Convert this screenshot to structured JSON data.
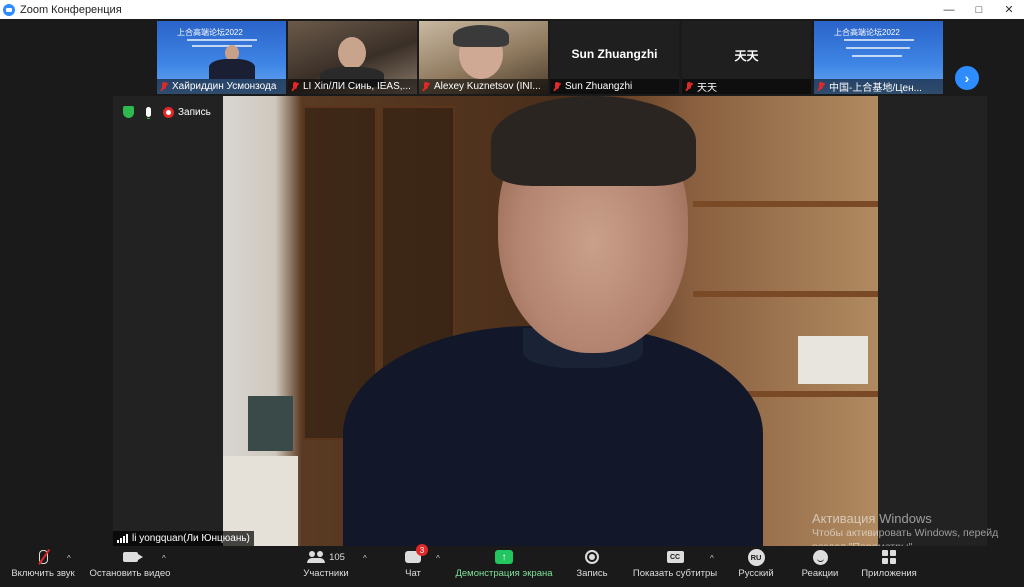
{
  "window": {
    "title": "Zoom Конференция",
    "controls": [
      "—",
      "□",
      "✕"
    ]
  },
  "participants": [
    {
      "name": "Хайриддин Усмонзода",
      "muted": true
    },
    {
      "name": "LI Xin/ЛИ Синь, IEAS,...",
      "muted": true
    },
    {
      "name": "Alexey Kuznetsov (INI...",
      "muted": true
    },
    {
      "name": "Sun  Zhuangzhi",
      "center_name": "Sun  Zhuangzhi",
      "muted": true
    },
    {
      "name": "天天",
      "center_name": "天天",
      "muted": true
    },
    {
      "name": "中国-上合基地/Цен...",
      "muted": true
    }
  ],
  "poster_text": "上合高端论坛2022",
  "main": {
    "recording_label": "Запись",
    "speaker_name": "li yongquan(Ли Юнцюань)"
  },
  "activation": {
    "title": "Активация Windows",
    "line1": "Чтобы активировать Windows, перейд",
    "line2": "раздел \"Параметры\"."
  },
  "toolbar": {
    "unmute": "Включить звук",
    "stop_video": "Остановить видео",
    "participants": "Участники",
    "participants_count": "105",
    "chat": "Чат",
    "chat_badge": "3",
    "share": "Демонстрация экрана",
    "record": "Запись",
    "captions": "Показать субтитры",
    "captions_icon": "CC",
    "language": "Русский",
    "language_icon": "RU",
    "reactions": "Реакции",
    "apps": "Приложения"
  },
  "colors": {
    "accent": "#2D8CFF",
    "share_green": "#22c55e",
    "muted_red": "#e02828",
    "shield_green": "#2fb84f"
  }
}
